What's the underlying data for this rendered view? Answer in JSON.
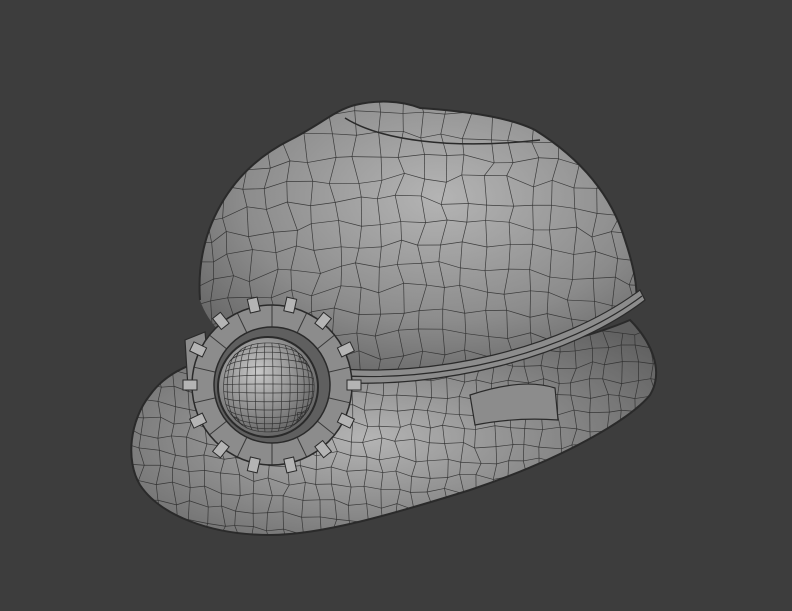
{
  "viewport": {
    "background_color": "#3d3d3d"
  },
  "model": {
    "kind": "mining-hard-hat-wireframe",
    "shell_color": "#8c8c8c",
    "shell_highlight": "#b4b4b4",
    "shell_shadow": "#5f5f5f",
    "wire_color": "#2a2a2a",
    "lamp_face_color": "#a8a8a8"
  }
}
